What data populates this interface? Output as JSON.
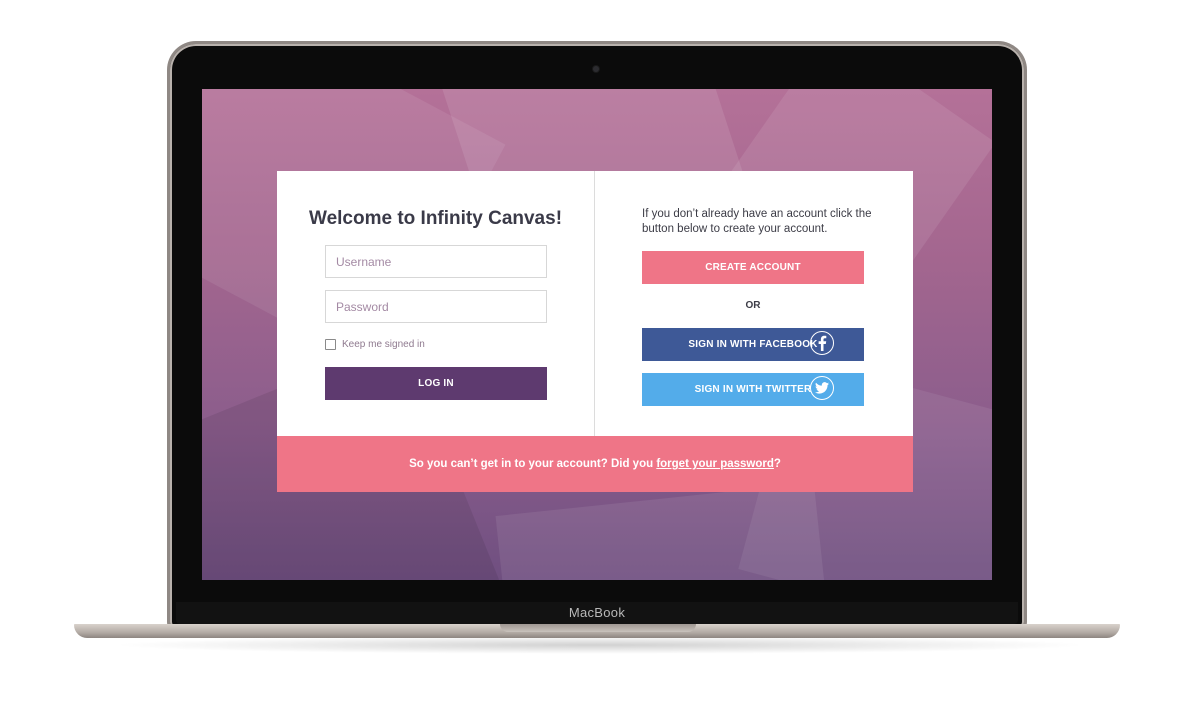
{
  "device": {
    "brand": "MacBook"
  },
  "login": {
    "title": "Welcome to Infinity Canvas!",
    "username_placeholder": "Username",
    "password_placeholder": "Password",
    "remember_label": "Keep me signed in",
    "login_button": "LOG IN"
  },
  "signup": {
    "info_text": "If you don’t already have an account click the button below to create your account.",
    "create_button": "CREATE ACCOUNT",
    "or_text": "OR",
    "facebook_button": "SIGN IN WITH FACEBOOK",
    "twitter_button": "SIGN IN WITH TWITTER"
  },
  "footer": {
    "text_before": "So you can’t get in to your account? Did you ",
    "link_text": "forget your password",
    "text_after": "?"
  },
  "colors": {
    "primary_purple": "#5e3a6f",
    "pink": "#ef7587",
    "facebook_blue": "#3e5997",
    "twitter_blue": "#53acea"
  },
  "icons": {
    "facebook": "facebook-icon",
    "twitter": "twitter-icon",
    "camera": "camera-icon"
  }
}
